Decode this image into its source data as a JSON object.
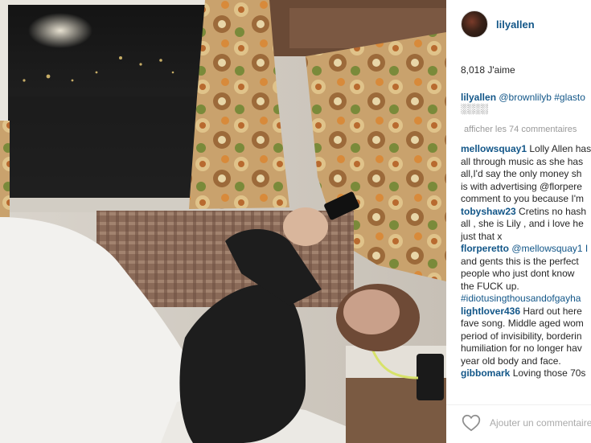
{
  "post": {
    "username": "lilyallen",
    "likes_text": "8,018 J'aime",
    "caption": {
      "user": "lilyallen",
      "text_line1": "@brownlilyb #glasto",
      "text_line2": "░░░░"
    },
    "view_comments_label": "afficher les 74 commentaires"
  },
  "comments": [
    {
      "user": "mellowsquay1",
      "lines": [
        "Lolly Allen has",
        "all through music as she has",
        "all,I'd say the only money sh",
        "is with advertising @florpere",
        "comment to you because I'm"
      ]
    },
    {
      "user": "tobyshaw23",
      "lines": [
        "Cretins no hash",
        "all , she is Lily , and i love he",
        "just that x"
      ]
    },
    {
      "user": "florperetto",
      "lines": [
        "@mellowsquay1 I",
        "and gents this is the perfect",
        "people who just dont know",
        "the FUCK up.",
        "#idiotusingthousandofgayha"
      ]
    },
    {
      "user": "lightlover436",
      "lines": [
        "Hard out here",
        "fave song. Middle aged wom",
        "period of invisibility, borderin",
        "humiliation for no longer hav",
        "year old body and face."
      ]
    },
    {
      "user": "gibbomark",
      "lines": [
        "Loving those 70s"
      ]
    }
  ],
  "footer": {
    "like_icon": "heart-outline-icon",
    "add_comment_placeholder": "Ajouter un commentaire..."
  },
  "colors": {
    "username_blue": "#125688",
    "muted_gray": "#999999",
    "text_dark": "#262626"
  }
}
